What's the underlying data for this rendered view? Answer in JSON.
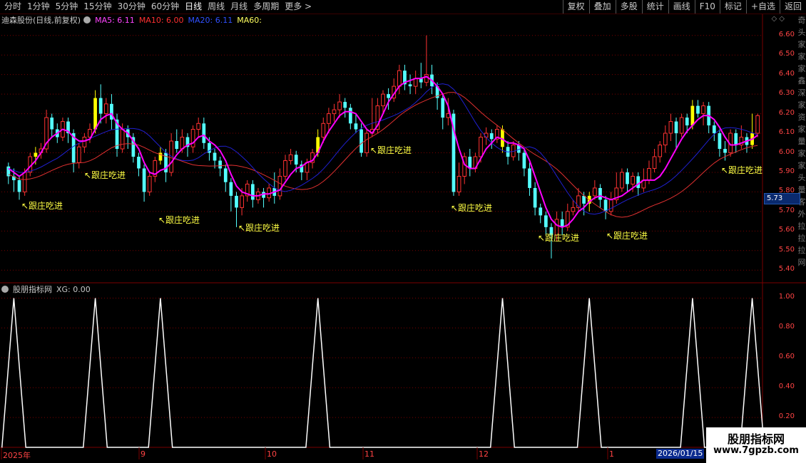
{
  "toolbar": {
    "periods": [
      "分时",
      "1分钟",
      "5分钟",
      "15分钟",
      "30分钟",
      "60分钟",
      "日线",
      "周线",
      "月线",
      "多周期",
      "更多 >"
    ],
    "active_period": "日线",
    "buttons": [
      "复权",
      "叠加",
      "多股",
      "统计",
      "画线",
      "F10",
      "标记",
      "+自选",
      "返回"
    ]
  },
  "main_header": {
    "stock_name": "迪森股份(日线,前复权)",
    "ma5": "MA5: 6.11",
    "ma10": "MA10: 6.00",
    "ma20": "MA20: 6.11",
    "ma60": "MA60:"
  },
  "sub_header": {
    "title": "股朋指标网",
    "xg": "XG: 0.00"
  },
  "colors": {
    "up": "#ff3232",
    "down": "#54ffff",
    "signal": "#ffff00",
    "ma5": "#ff00ff",
    "ma10": "#e03030",
    "ma20": "#2020d0",
    "axis": "#ff4444",
    "grid": "#7a0000"
  },
  "price_tag": "5.73",
  "annotation_text": "↖跟庄吃进",
  "date_labels": [
    "2025年",
    "9",
    "10",
    "11",
    "12",
    "1"
  ],
  "selected_date": "2026/01/15",
  "side_strip_text": "奇头家家家鑫深家资家量家家头量客外拉拉拉网",
  "watermark": {
    "line1": "股朋指标网",
    "line2": "www.7gpzb.com"
  },
  "chart_data": [
    {
      "type": "candlestick",
      "title": "迪森股份(日线,前复权)",
      "ylim": [
        5.35,
        6.65
      ],
      "y_ticks": [
        5.4,
        5.5,
        5.6,
        5.7,
        5.8,
        5.9,
        6.0,
        6.1,
        6.2,
        6.3,
        6.4,
        6.5,
        6.6
      ],
      "candles": [
        [
          5.93,
          5.88,
          5.95,
          5.84
        ],
        [
          5.88,
          5.86,
          5.92,
          5.8
        ],
        [
          5.86,
          5.8,
          5.88,
          5.76
        ],
        [
          5.8,
          5.9,
          5.92,
          5.78
        ],
        [
          5.9,
          5.98,
          6.0,
          5.88
        ],
        [
          5.98,
          6.0,
          6.03,
          5.94
        ],
        [
          6.0,
          6.02,
          6.05,
          5.97
        ],
        [
          6.02,
          6.18,
          6.22,
          6.0
        ],
        [
          6.18,
          6.12,
          6.2,
          6.08
        ],
        [
          6.12,
          6.08,
          6.15,
          6.05
        ],
        [
          6.08,
          6.16,
          6.18,
          6.06
        ],
        [
          6.16,
          6.1,
          6.18,
          6.05
        ],
        [
          6.1,
          5.95,
          6.12,
          5.9
        ],
        [
          5.95,
          6.03,
          6.05,
          5.92
        ],
        [
          6.03,
          6.08,
          6.1,
          6.0
        ],
        [
          6.08,
          6.12,
          6.15,
          6.05
        ],
        [
          6.12,
          6.28,
          6.32,
          6.1
        ],
        [
          6.28,
          6.2,
          6.35,
          6.15
        ],
        [
          6.2,
          6.25,
          6.28,
          6.15
        ],
        [
          6.25,
          6.17,
          6.3,
          6.12
        ],
        [
          6.17,
          6.02,
          6.2,
          5.98
        ],
        [
          6.02,
          6.12,
          6.15,
          6.0
        ],
        [
          6.12,
          6.08,
          6.14,
          6.02
        ],
        [
          6.08,
          5.98,
          6.1,
          5.95
        ],
        [
          5.98,
          5.92,
          6.0,
          5.88
        ],
        [
          5.92,
          5.8,
          5.94,
          5.75
        ],
        [
          5.8,
          5.88,
          5.9,
          5.78
        ],
        [
          5.88,
          5.96,
          5.98,
          5.85
        ],
        [
          5.96,
          6.0,
          6.03,
          5.94
        ],
        [
          6.0,
          5.9,
          6.02,
          5.85
        ],
        [
          5.9,
          6.06,
          6.1,
          5.88
        ],
        [
          6.06,
          6.02,
          6.12,
          6.0
        ],
        [
          6.02,
          6.08,
          6.12,
          6.0
        ],
        [
          6.08,
          6.03,
          6.1,
          5.98
        ],
        [
          6.03,
          6.12,
          6.14,
          6.0
        ],
        [
          6.12,
          6.15,
          6.18,
          6.08
        ],
        [
          6.15,
          6.05,
          6.18,
          6.02
        ],
        [
          6.05,
          6.0,
          6.08,
          5.96
        ],
        [
          6.0,
          5.96,
          6.02,
          5.92
        ],
        [
          5.96,
          5.92,
          5.98,
          5.88
        ],
        [
          5.92,
          5.85,
          5.94,
          5.8
        ],
        [
          5.85,
          5.78,
          5.87,
          5.7
        ],
        [
          5.78,
          5.72,
          5.8,
          5.62
        ],
        [
          5.72,
          5.78,
          5.82,
          5.68
        ],
        [
          5.78,
          5.84,
          5.86,
          5.75
        ],
        [
          5.84,
          5.76,
          5.86,
          5.72
        ],
        [
          5.76,
          5.8,
          5.82,
          5.74
        ],
        [
          5.8,
          5.77,
          5.82,
          5.72
        ],
        [
          5.77,
          5.82,
          5.84,
          5.75
        ],
        [
          5.82,
          5.78,
          5.9,
          5.74
        ],
        [
          5.78,
          5.88,
          5.92,
          5.76
        ],
        [
          5.88,
          5.96,
          5.99,
          5.86
        ],
        [
          5.96,
          5.99,
          6.02,
          5.94
        ],
        [
          5.99,
          5.94,
          6.01,
          5.9
        ],
        [
          5.94,
          5.9,
          5.96,
          5.86
        ],
        [
          5.9,
          5.95,
          5.97,
          5.86
        ],
        [
          5.95,
          6.0,
          6.02,
          5.92
        ],
        [
          6.0,
          6.08,
          6.12,
          5.98
        ],
        [
          6.08,
          6.15,
          6.18,
          6.05
        ],
        [
          6.15,
          6.2,
          6.23,
          6.1
        ],
        [
          6.2,
          6.22,
          6.25,
          6.16
        ],
        [
          6.22,
          6.26,
          6.3,
          6.18
        ],
        [
          6.26,
          6.23,
          6.28,
          6.18
        ],
        [
          6.23,
          6.15,
          6.25,
          6.12
        ],
        [
          6.15,
          6.12,
          6.2,
          6.1
        ],
        [
          6.12,
          6.0,
          6.15,
          5.98
        ],
        [
          6.0,
          6.1,
          6.12,
          5.98
        ],
        [
          6.1,
          6.12,
          6.28,
          6.08
        ],
        [
          6.12,
          6.24,
          6.28,
          6.1
        ],
        [
          6.24,
          6.3,
          6.32,
          6.2
        ],
        [
          6.3,
          6.28,
          6.33,
          6.22
        ],
        [
          6.28,
          6.34,
          6.38,
          6.26
        ],
        [
          6.34,
          6.42,
          6.45,
          6.3
        ],
        [
          6.42,
          6.35,
          6.45,
          6.32
        ],
        [
          6.35,
          6.34,
          6.4,
          6.3
        ],
        [
          6.34,
          6.38,
          6.42,
          6.3
        ],
        [
          6.38,
          6.36,
          6.46,
          6.33
        ],
        [
          6.36,
          6.4,
          6.6,
          6.34
        ],
        [
          6.4,
          6.34,
          6.45,
          6.3
        ],
        [
          6.34,
          6.28,
          6.36,
          6.22
        ],
        [
          6.28,
          6.18,
          6.3,
          6.12
        ],
        [
          6.18,
          6.2,
          6.28,
          6.14
        ],
        [
          6.2,
          5.8,
          6.22,
          5.78
        ],
        [
          5.8,
          5.88,
          5.95,
          5.78
        ],
        [
          5.88,
          5.98,
          6.0,
          5.84
        ],
        [
          5.98,
          5.92,
          6.02,
          5.88
        ],
        [
          5.92,
          5.98,
          6.0,
          5.9
        ],
        [
          5.98,
          6.08,
          6.1,
          5.95
        ],
        [
          6.08,
          6.1,
          6.13,
          6.04
        ],
        [
          6.1,
          6.07,
          6.12,
          6.02
        ],
        [
          6.07,
          6.12,
          6.14,
          6.05
        ],
        [
          6.12,
          6.03,
          6.14,
          6.0
        ],
        [
          6.03,
          5.98,
          6.06,
          5.94
        ],
        [
          5.98,
          6.04,
          6.06,
          5.96
        ],
        [
          6.04,
          6.0,
          6.06,
          5.96
        ],
        [
          6.0,
          5.92,
          6.02,
          5.88
        ],
        [
          5.92,
          5.82,
          5.95,
          5.78
        ],
        [
          5.82,
          5.72,
          5.85,
          5.68
        ],
        [
          5.72,
          5.68,
          5.74,
          5.64
        ],
        [
          5.68,
          5.62,
          5.7,
          5.58
        ],
        [
          5.62,
          5.58,
          5.64,
          5.46
        ],
        [
          5.58,
          5.66,
          5.7,
          5.55
        ],
        [
          5.66,
          5.62,
          5.7,
          5.58
        ],
        [
          5.62,
          5.7,
          5.74,
          5.6
        ],
        [
          5.7,
          5.72,
          5.76,
          5.68
        ],
        [
          5.72,
          5.78,
          5.82,
          5.7
        ],
        [
          5.78,
          5.74,
          5.8,
          5.68
        ],
        [
          5.74,
          5.78,
          5.8,
          5.7
        ],
        [
          5.78,
          5.82,
          5.86,
          5.76
        ],
        [
          5.82,
          5.76,
          5.84,
          5.72
        ],
        [
          5.76,
          5.7,
          5.78,
          5.66
        ],
        [
          5.7,
          5.76,
          5.8,
          5.68
        ],
        [
          5.76,
          5.82,
          5.9,
          5.74
        ],
        [
          5.82,
          5.9,
          5.92,
          5.8
        ],
        [
          5.9,
          5.84,
          5.92,
          5.8
        ],
        [
          5.84,
          5.88,
          5.9,
          5.8
        ],
        [
          5.88,
          5.82,
          5.9,
          5.78
        ],
        [
          5.82,
          5.86,
          5.92,
          5.8
        ],
        [
          5.86,
          5.92,
          5.96,
          5.84
        ],
        [
          5.92,
          5.98,
          6.02,
          5.9
        ],
        [
          5.98,
          6.04,
          6.06,
          5.95
        ],
        [
          6.04,
          6.1,
          6.14,
          6.0
        ],
        [
          6.1,
          6.16,
          6.2,
          6.06
        ],
        [
          6.16,
          6.1,
          6.18,
          6.02
        ],
        [
          6.1,
          6.18,
          6.2,
          6.08
        ],
        [
          6.18,
          6.14,
          6.2,
          6.1
        ],
        [
          6.14,
          6.24,
          6.27,
          6.12
        ],
        [
          6.24,
          6.2,
          6.27,
          6.18
        ],
        [
          6.2,
          6.24,
          6.26,
          6.14
        ],
        [
          6.24,
          6.14,
          6.26,
          6.1
        ],
        [
          6.14,
          6.1,
          6.16,
          6.06
        ],
        [
          6.1,
          6.02,
          6.12,
          5.98
        ],
        [
          6.02,
          6.0,
          6.06,
          5.96
        ],
        [
          6.0,
          6.1,
          6.12,
          5.98
        ],
        [
          6.1,
          6.04,
          6.12,
          6.0
        ],
        [
          6.04,
          6.08,
          6.14,
          6.02
        ],
        [
          6.08,
          6.04,
          6.1,
          6.0
        ],
        [
          6.04,
          6.1,
          6.2,
          6.02
        ],
        [
          6.1,
          6.19,
          6.2,
          6.08
        ]
      ],
      "signal_candles": [
        5,
        16,
        28,
        57,
        91,
        107,
        126,
        137
      ],
      "ma5": [
        5.92,
        5.9,
        5.88,
        5.9,
        5.93,
        5.96,
        6.0,
        6.05,
        6.08,
        6.1,
        6.12,
        6.11,
        6.08,
        6.06,
        6.06,
        6.07,
        6.12,
        6.17,
        6.19,
        6.2,
        6.15,
        6.12,
        6.1,
        6.06,
        6.02,
        5.95,
        5.9,
        5.89,
        5.91,
        5.92,
        5.95,
        5.99,
        6.02,
        6.04,
        6.05,
        6.08,
        6.09,
        6.06,
        6.04,
        6.01,
        5.96,
        5.89,
        5.83,
        5.8,
        5.79,
        5.78,
        5.78,
        5.79,
        5.79,
        5.8,
        5.81,
        5.85,
        5.89,
        5.92,
        5.93,
        5.95,
        5.96,
        6.0,
        6.06,
        6.11,
        6.15,
        6.19,
        6.21,
        6.21,
        6.2,
        6.16,
        6.12,
        6.1,
        6.14,
        6.2,
        6.26,
        6.3,
        6.34,
        6.36,
        6.37,
        6.38,
        6.38,
        6.39,
        6.37,
        6.34,
        6.3,
        6.24,
        6.12,
        6.02,
        5.94,
        5.92,
        5.92,
        5.97,
        6.02,
        6.05,
        6.08,
        6.07,
        6.05,
        6.05,
        6.04,
        6.02,
        5.96,
        5.88,
        5.8,
        5.72,
        5.66,
        5.63,
        5.62,
        5.63,
        5.66,
        5.7,
        5.72,
        5.75,
        5.77,
        5.78,
        5.77,
        5.76,
        5.77,
        5.78,
        5.8,
        5.82,
        5.84,
        5.86,
        5.86,
        5.86,
        5.88,
        5.92,
        5.97,
        6.02,
        6.07,
        6.11,
        6.14,
        6.17,
        6.19,
        6.19,
        6.17,
        6.13,
        6.08,
        6.04,
        6.04,
        6.05,
        6.06,
        6.07,
        6.09
      ],
      "ma10": 6.0,
      "ma20": 6.11,
      "ma60": null
    },
    {
      "type": "line",
      "title": "股朋指标网",
      "ylim": [
        0.0,
        1.05
      ],
      "y_ticks": [
        0.2,
        0.4,
        0.6,
        0.8,
        1.0
      ],
      "series": [
        {
          "name": "XG",
          "spikes_at_candle": [
            1,
            16,
            28,
            57,
            91,
            107,
            126,
            137
          ],
          "peak": 1.0
        }
      ]
    }
  ]
}
